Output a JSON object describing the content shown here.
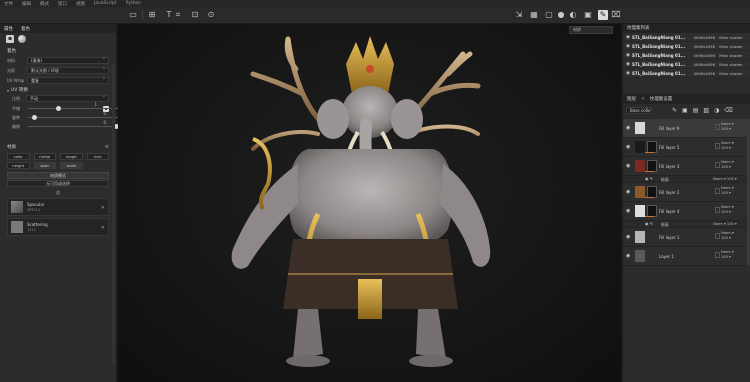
{
  "menubar": {
    "items": [
      "文件",
      "编辑",
      "模式",
      "窗口",
      "视图",
      "JavaScript",
      "Python"
    ]
  },
  "left": {
    "tabs": [
      "属性",
      "着色"
    ],
    "section_title": "着色",
    "fields": [
      {
        "label": "材料",
        "value": "(清漆)"
      },
      {
        "label": "光照",
        "value": "默认光照 / 环境"
      },
      {
        "label": "UV Wrap",
        "value": "重复"
      }
    ],
    "uv_header": "UV 转换",
    "uv_fields": [
      {
        "label": "比例",
        "value": "手动"
      }
    ],
    "sliders": [
      {
        "label": "平铺",
        "value": "1",
        "pos": 0.3
      },
      {
        "label": "旋转",
        "value": "0",
        "pos": 0.05
      },
      {
        "label": "偏移",
        "value": "0",
        "pos": 0.8
      }
    ],
    "channels_title": "材质",
    "channels": [
      "color",
      "metal",
      "rough",
      "nrm",
      "height",
      "spec",
      "scatt"
    ],
    "btn_mode": "材质模式",
    "btn_apply": "无可用或选择",
    "group_label": "组",
    "materials": [
      {
        "name": "Specular",
        "sub": "SRT111"
      },
      {
        "name": "Scattering",
        "sub": "1111"
      }
    ]
  },
  "viewport": {
    "dropdown": "材质"
  },
  "right": {
    "title": "纹理集列表",
    "texture_sets": [
      {
        "name": "STL_BaiSangNiang 01...",
        "res": "4096x4096",
        "shader": "Main shader"
      },
      {
        "name": "STL_BaiSangNiang 01...",
        "res": "4096x4096",
        "shader": "Main shader"
      },
      {
        "name": "STL_BaiSangNiang 01...",
        "res": "4096x4096",
        "shader": "Main shader"
      },
      {
        "name": "STL_BaiSangNiang 01...",
        "res": "4096x4096",
        "shader": "Main shader"
      },
      {
        "name": "STL_BaiSangNiang 01...",
        "res": "4096x4096",
        "shader": "Main shader"
      }
    ],
    "tab_layers": "图层",
    "tab_settings": "纹理集设置",
    "base_dropdown": "Base color",
    "layers": [
      {
        "name": "Fill layer 9",
        "blend": "Norm",
        "opacity": "100",
        "thumb": "#d9d9d9",
        "mask": null
      },
      {
        "name": "Fill layer 5",
        "blend": "Norm",
        "opacity": "100",
        "thumb": "#1a1a1a",
        "mask": "#111"
      },
      {
        "name": "Fill layer 3",
        "blend": "Norm",
        "opacity": "100",
        "thumb": "#7a2a22",
        "mask": "#111"
      },
      {
        "name": "Fill layer 2",
        "blend": "Norm",
        "opacity": "100",
        "thumb": "#8a5a2a",
        "mask": "#111"
      },
      {
        "name": "Fill layer 4",
        "blend": "Norm",
        "opacity": "100",
        "thumb": "#dedede",
        "mask": "#111"
      },
      {
        "name": "Fill layer 1",
        "blend": "Norm",
        "opacity": "100",
        "thumb": "#b5b5b5",
        "mask": null
      },
      {
        "name": "Layer 1",
        "blend": "Norm",
        "opacity": "100",
        "thumb": "#5a5a5a",
        "mask": null
      }
    ],
    "fx_label": "绘画",
    "fx_blend": "Norm",
    "fx_opacity": "100"
  }
}
